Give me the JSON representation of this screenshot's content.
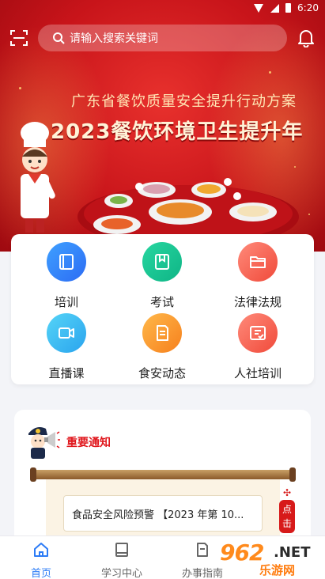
{
  "status_bar": {
    "time": "6:20"
  },
  "search": {
    "placeholder": "请输入搜索关键词"
  },
  "banner": {
    "subtitle": "广东省餐饮质量安全提升行动方案",
    "title": "2023餐饮环境卫生提升年"
  },
  "menu": {
    "items": [
      {
        "label": "培训",
        "icon": "book-icon",
        "color": "#2c6cf4"
      },
      {
        "label": "考试",
        "icon": "exam-book-icon",
        "color": "#0fb586"
      },
      {
        "label": "法律法规",
        "icon": "folder-icon",
        "color": "#f04a3a"
      },
      {
        "label": "直播课",
        "icon": "video-camera-icon",
        "color": "#2aa4ee"
      },
      {
        "label": "食安动态",
        "icon": "document-icon",
        "color": "#f6801d"
      },
      {
        "label": "人社培训",
        "icon": "certificate-icon",
        "color": "#f04a3a"
      }
    ]
  },
  "notice": {
    "title": "重要通知",
    "items": [
      {
        "text": "食品安全风险预警 【2023 年第 10..."
      }
    ],
    "click_tag": "点击"
  },
  "bottom_nav": {
    "items": [
      {
        "label": "首页",
        "icon": "home-icon",
        "active": true
      },
      {
        "label": "学习中心",
        "icon": "book-icon",
        "active": false
      },
      {
        "label": "办事指南",
        "icon": "document-icon",
        "active": false
      }
    ]
  },
  "watermark": {
    "number": "962",
    "suffix": ".NET",
    "text": "乐游网"
  },
  "colors": {
    "accent": "#2d7cf6",
    "banner_red": "#c8141a",
    "notice_red": "#e0161c"
  }
}
